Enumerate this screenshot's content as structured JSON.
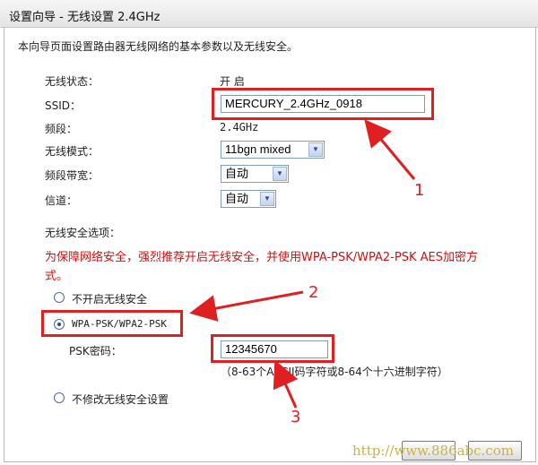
{
  "title": "设置向导 - 无线设置 2.4GHz",
  "intro": "本向导页面设置路由器无线网络的基本参数以及无线安全。",
  "fields": {
    "status_label": "无线状态：",
    "status_value": "开 启",
    "ssid_label": "SSID：",
    "ssid_value": "MERCURY_2.4GHz_0918",
    "band_label": "频段：",
    "band_value": "2.4GHz",
    "mode_label": "无线模式：",
    "mode_value": "11bgn mixed",
    "width_label": "频段带宽：",
    "width_value": "自动",
    "channel_label": "信道：",
    "channel_value": "自动"
  },
  "security": {
    "section_label": "无线安全选项：",
    "warning": "为保障网络安全，强烈推荐开启无线安全，并使用WPA-PSK/WPA2-PSK AES加密方式。",
    "warning_line1": "为保障网络安全，强烈推荐开启无线安全，并使用WPA-PSK/WPA2-PSK AES加密方",
    "warning_line2": "式。",
    "option_off": "不开启无线安全",
    "option_wpa": "WPA-PSK/WPA2-PSK",
    "psk_label": "PSK密码：",
    "psk_value": "12345670",
    "psk_hint": "（8-63个ASCII码字符或8-64个十六进制字符）",
    "option_keep": "不修改无线安全设置"
  },
  "annotations": {
    "one": "1",
    "two": "2",
    "three": "3"
  },
  "watermark": "http://www.886abc.com",
  "colors": {
    "annotation": "#e02020",
    "warning": "#d01010",
    "watermark": "#c9b24a"
  }
}
